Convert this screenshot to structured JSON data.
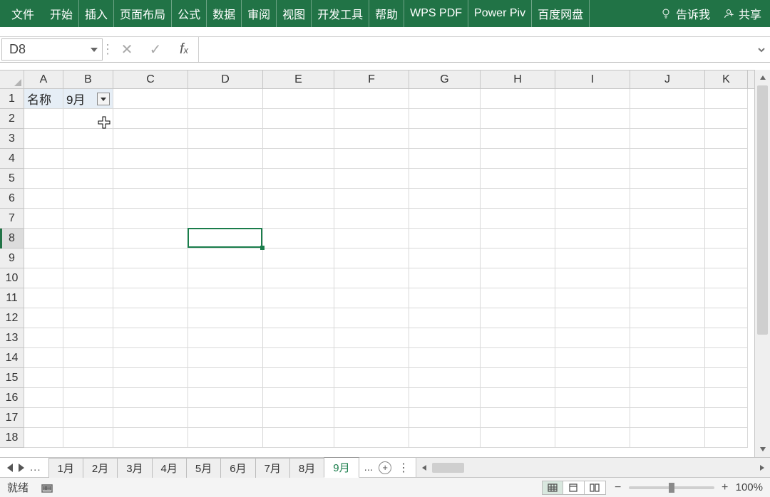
{
  "ribbon": {
    "tabs": [
      "文件",
      "开始",
      "插入",
      "页面布局",
      "公式",
      "数据",
      "审阅",
      "视图",
      "开发工具",
      "帮助",
      "WPS PDF",
      "Power Piv",
      "百度网盘"
    ],
    "tell_me": "告诉我",
    "share": "共享"
  },
  "name_box": {
    "value": "D8"
  },
  "formula_bar": {
    "value": ""
  },
  "columns": [
    "A",
    "B",
    "C",
    "D",
    "E",
    "F",
    "G",
    "H",
    "I",
    "J",
    "K"
  ],
  "rows": [
    1,
    2,
    3,
    4,
    5,
    6,
    7,
    8,
    9,
    10,
    11,
    12,
    13,
    14,
    15,
    16,
    17,
    18
  ],
  "cells": {
    "A1": "名称",
    "B1": "9月"
  },
  "active_cell": "D8",
  "cursor_pos": {
    "row": 3,
    "col": "B"
  },
  "sheet_tabs": {
    "left_ellipsis": "...",
    "tabs": [
      "1月",
      "2月",
      "3月",
      "4月",
      "5月",
      "6月",
      "7月",
      "8月",
      "9月"
    ],
    "active": "9月",
    "right_ellipsis": "..."
  },
  "status": {
    "ready": "就绪",
    "zoom": "100%"
  }
}
